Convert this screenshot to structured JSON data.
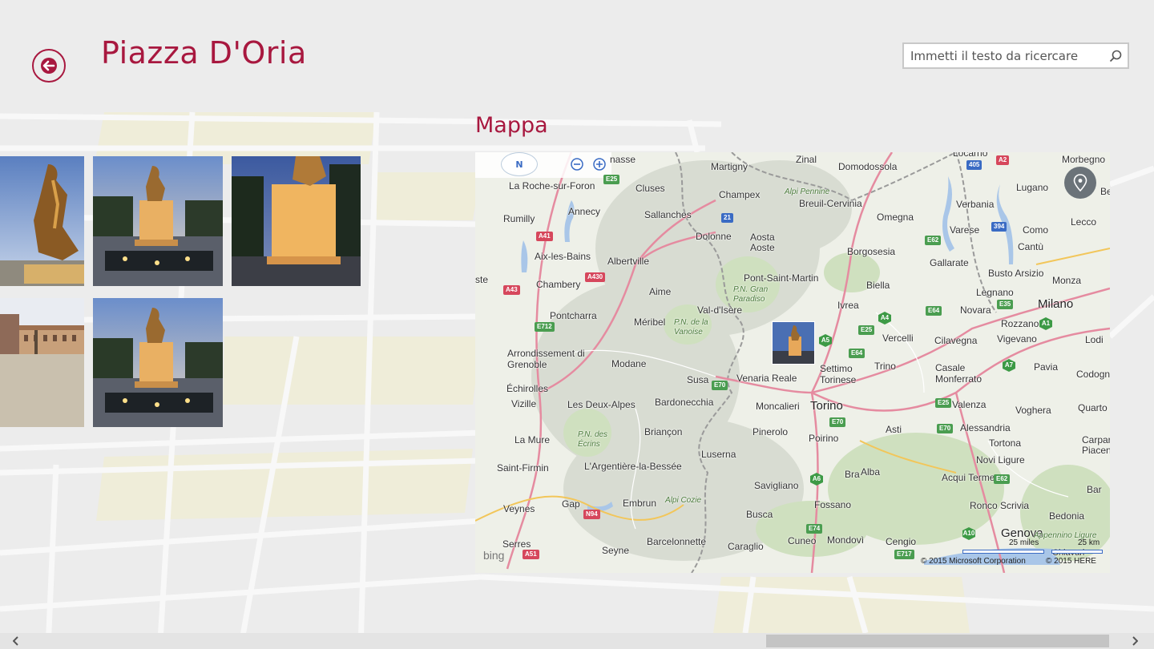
{
  "header": {
    "title": "Piazza D'Oria",
    "back_icon": "arrow-left-icon",
    "accent_color": "#a8183f"
  },
  "search": {
    "placeholder": "Immetti il testo da ricercare",
    "icon": "search-icon"
  },
  "photos": {
    "count": 5,
    "items": [
      {
        "subject": "statue-closeup"
      },
      {
        "subject": "statue-dusk"
      },
      {
        "subject": "statue-night"
      },
      {
        "subject": "square-buildings"
      },
      {
        "subject": "statue-dusk"
      }
    ]
  },
  "map_section": {
    "title": "Mappa",
    "controls": {
      "compass_label": "N",
      "zoom_out_icon": "zoom-out-icon",
      "zoom_in_icon": "zoom-in-icon",
      "locate_icon": "location-pin-icon"
    },
    "places": [
      {
        "name": "nasse"
      },
      {
        "name": "La Roche-sur-Foron"
      },
      {
        "name": "Cluses"
      },
      {
        "name": "Martigny"
      },
      {
        "name": "Zinal"
      },
      {
        "name": "Domodossola"
      },
      {
        "name": "Locarno"
      },
      {
        "name": "Morbegno"
      },
      {
        "name": "Annecy"
      },
      {
        "name": "Rumilly"
      },
      {
        "name": "Sallanches"
      },
      {
        "name": "Champex"
      },
      {
        "name": "Breuil-Cervinia"
      },
      {
        "name": "Verbania"
      },
      {
        "name": "Lugano"
      },
      {
        "name": "Omegna"
      },
      {
        "name": "Dolonne"
      },
      {
        "name": "Aosta"
      },
      {
        "name": "Aoste"
      },
      {
        "name": "Varese"
      },
      {
        "name": "Como"
      },
      {
        "name": "Lecco"
      },
      {
        "name": "Cantù"
      },
      {
        "name": "Aix-les-Bains"
      },
      {
        "name": "Albertville"
      },
      {
        "name": "Borgosesia"
      },
      {
        "name": "Gallarate"
      },
      {
        "name": "Chambery"
      },
      {
        "name": "Pont-Saint-Martin"
      },
      {
        "name": "Biella"
      },
      {
        "name": "Busto Arsizio"
      },
      {
        "name": "Monza"
      },
      {
        "name": "Aime"
      },
      {
        "name": "Legnano"
      },
      {
        "name": "Milano"
      },
      {
        "name": "Pontcharra"
      },
      {
        "name": "Val-d'Isère"
      },
      {
        "name": "Ivrea"
      },
      {
        "name": "Novara"
      },
      {
        "name": "Méribel"
      },
      {
        "name": "Rozzano"
      },
      {
        "name": "Vercelli"
      },
      {
        "name": "Cilavegna"
      },
      {
        "name": "Vigevano"
      },
      {
        "name": "Lodi"
      },
      {
        "name": "Arrondissement di Grenoble"
      },
      {
        "name": "Modane"
      },
      {
        "name": "Trino"
      },
      {
        "name": "Settimo Torinese"
      },
      {
        "name": "Casale Monferrato"
      },
      {
        "name": "Pavia"
      },
      {
        "name": "Codogno"
      },
      {
        "name": "Venaria Reale"
      },
      {
        "name": "Susa"
      },
      {
        "name": "Échirolles"
      },
      {
        "name": "Bardonecchia"
      },
      {
        "name": "Moncalieri"
      },
      {
        "name": "Torino"
      },
      {
        "name": "Vizille"
      },
      {
        "name": "Les Deux-Alpes"
      },
      {
        "name": "Valenza"
      },
      {
        "name": "Voghera"
      },
      {
        "name": "Quarto"
      },
      {
        "name": "Pinerolo"
      },
      {
        "name": "Briançon"
      },
      {
        "name": "Asti"
      },
      {
        "name": "Alessandria"
      },
      {
        "name": "Poirino"
      },
      {
        "name": "La Mure"
      },
      {
        "name": "Tortona"
      },
      {
        "name": "Piacen"
      },
      {
        "name": "Carpar"
      },
      {
        "name": "Luserna"
      },
      {
        "name": "Novi Ligure"
      },
      {
        "name": "Saint-Firmin"
      },
      {
        "name": "L'Argentière-la-Bessée"
      },
      {
        "name": "Bra"
      },
      {
        "name": "Alba"
      },
      {
        "name": "Acqui Terme"
      },
      {
        "name": "Savigliano"
      },
      {
        "name": "Bar"
      },
      {
        "name": "Veynes"
      },
      {
        "name": "Gap"
      },
      {
        "name": "Embrun"
      },
      {
        "name": "Fossano"
      },
      {
        "name": "Ronco Scrivia"
      },
      {
        "name": "Busca"
      },
      {
        "name": "Bedonia"
      },
      {
        "name": "Genova"
      },
      {
        "name": "Serres"
      },
      {
        "name": "Barcelonnette"
      },
      {
        "name": "Cuneo"
      },
      {
        "name": "Mondovì"
      },
      {
        "name": "Cengio"
      },
      {
        "name": "Seyne"
      },
      {
        "name": "Caraglio"
      },
      {
        "name": "Chiavari"
      },
      {
        "name": "ste"
      },
      {
        "name": "Be"
      }
    ],
    "regions": [
      {
        "name": "Alpi Pennine"
      },
      {
        "name": "P.N. Gran Paradiso"
      },
      {
        "name": "P.N. de la Vanoise"
      },
      {
        "name": "P.N. des Écrins"
      },
      {
        "name": "Alpi Cozie"
      },
      {
        "name": "Appennino Ligure"
      }
    ],
    "road_shields": [
      {
        "label": "E25"
      },
      {
        "label": "21"
      },
      {
        "label": "405"
      },
      {
        "label": "A2"
      },
      {
        "label": "A41"
      },
      {
        "label": "E62"
      },
      {
        "label": "394"
      },
      {
        "label": "A430"
      },
      {
        "label": "A43"
      },
      {
        "label": "E64"
      },
      {
        "label": "E35"
      },
      {
        "label": "A4"
      },
      {
        "label": "E712"
      },
      {
        "label": "A5"
      },
      {
        "label": "E25"
      },
      {
        "label": "A1"
      },
      {
        "label": "E64"
      },
      {
        "label": "A7"
      },
      {
        "label": "E70"
      },
      {
        "label": "E25"
      },
      {
        "label": "E70"
      },
      {
        "label": "E70"
      },
      {
        "label": "A6"
      },
      {
        "label": "E62"
      },
      {
        "label": "N94"
      },
      {
        "label": "E74"
      },
      {
        "label": "A10"
      },
      {
        "label": "E717"
      },
      {
        "label": "A51"
      }
    ],
    "scale": {
      "miles": "25 miles",
      "km": "25 km"
    },
    "attribution": {
      "brand": "bing",
      "copyright_ms": "© 2015 Microsoft Corporation",
      "copyright_here": "© 2015 HERE"
    }
  },
  "scrollbar": {
    "left_icon": "chevron-left-icon",
    "right_icon": "chevron-right-icon"
  }
}
